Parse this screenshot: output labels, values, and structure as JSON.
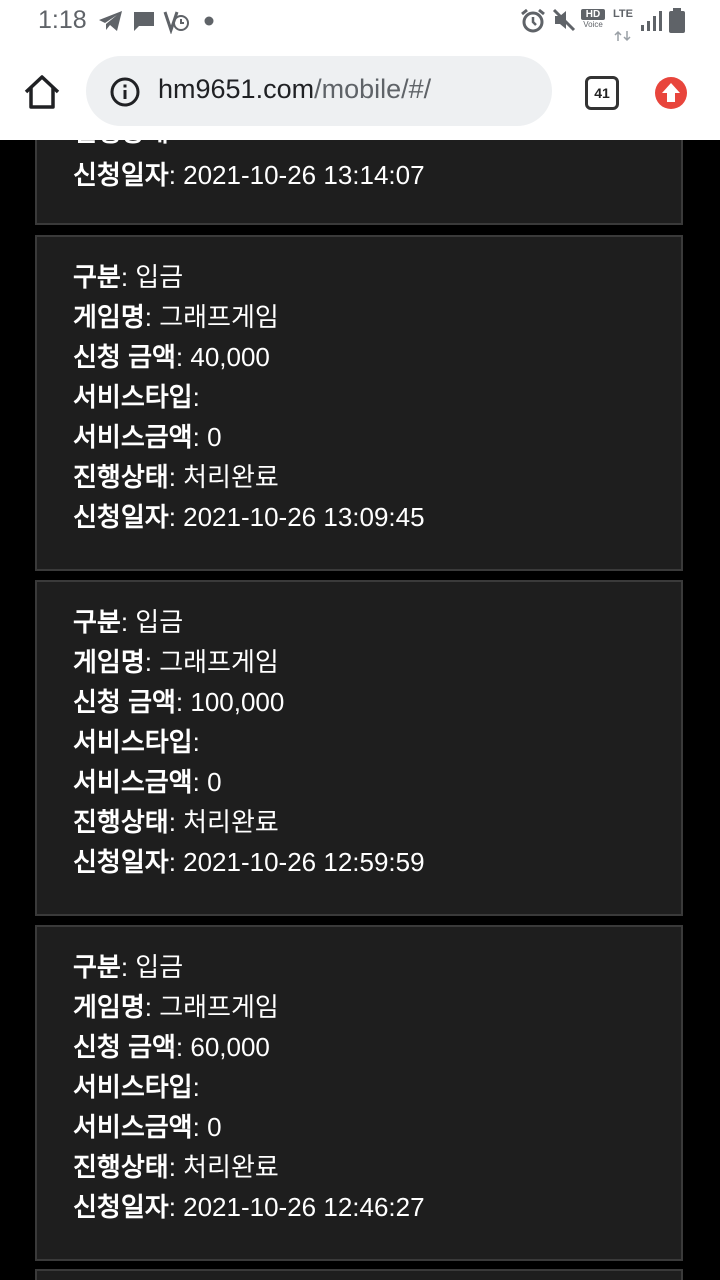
{
  "status_bar": {
    "time": "1:18",
    "hd_label": "HD",
    "voice_label": "Voice",
    "lte_label": "LTE"
  },
  "browser": {
    "url_host": "hm9651.com",
    "url_path": "/mobile/#/",
    "tab_count": "41"
  },
  "labels": {
    "type": "구분",
    "game_name": "게임명",
    "amount": "신청 금액",
    "service_type": "서비스타입",
    "service_amount": "서비스금액",
    "progress": "진행상태",
    "request_date": "신청일자"
  },
  "top_partial_card": {
    "request_date": "2021-10-26 13:14:07"
  },
  "cards": [
    {
      "type": "입금",
      "game_name": "그래프게임",
      "amount": "40,000",
      "service_type": "",
      "service_amount": "0",
      "progress": "처리완료",
      "request_date": "2021-10-26 13:09:45"
    },
    {
      "type": "입금",
      "game_name": "그래프게임",
      "amount": "100,000",
      "service_type": "",
      "service_amount": "0",
      "progress": "처리완료",
      "request_date": "2021-10-26 12:59:59"
    },
    {
      "type": "입금",
      "game_name": "그래프게임",
      "amount": "60,000",
      "service_type": "",
      "service_amount": "0",
      "progress": "처리완료",
      "request_date": "2021-10-26 12:46:27"
    }
  ]
}
